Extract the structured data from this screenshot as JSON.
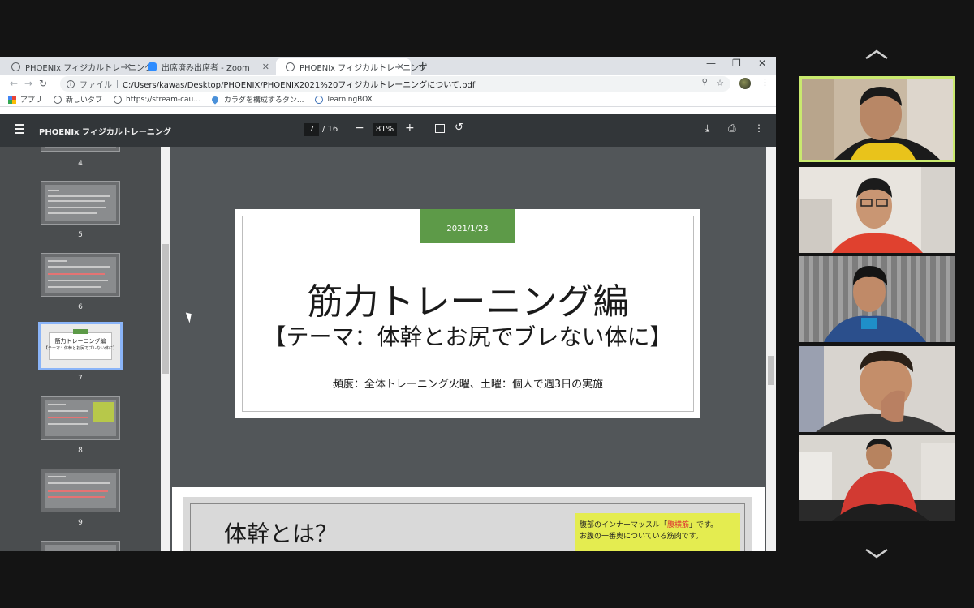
{
  "browser": {
    "tabs": [
      {
        "label": "PHOENIx フィジカルトレーニング",
        "icon": "globe-icon",
        "active": false
      },
      {
        "label": "出席済み出席者 - Zoom",
        "icon": "zoom-icon",
        "active": false
      },
      {
        "label": "PHOENIx フィジカルトレーニング",
        "icon": "globe-icon",
        "active": true
      }
    ],
    "new_tab": "+",
    "address": {
      "scheme_label": "ファイル",
      "url": "C:/Users/kawas/Desktop/PHOENIX/PHOENIX2021%20フィジカルトレーニングについて.pdf"
    },
    "bookmarks": [
      {
        "label": "アプリ",
        "icon": "apps-grid-icon"
      },
      {
        "label": "新しいタブ",
        "icon": "globe-icon"
      },
      {
        "label": "https://stream-cau...",
        "icon": "globe-icon"
      },
      {
        "label": "カラダを構成するタン...",
        "icon": "drop-icon"
      },
      {
        "label": "learningBOX",
        "icon": "learningbox-icon"
      }
    ]
  },
  "pdf": {
    "title": "PHOENIx フィジカルトレーニング",
    "current_page": "7",
    "page_total": "/ 16",
    "zoom": "81%",
    "thumbnails": [
      {
        "num": "4"
      },
      {
        "num": "5"
      },
      {
        "num": "6"
      },
      {
        "num": "7",
        "selected": true,
        "title": "筋力トレーニング編",
        "subtitle": "【テーマ：体幹とお尻でブレない体に】"
      },
      {
        "num": "8"
      },
      {
        "num": "9"
      }
    ],
    "slide": {
      "date": "2021/1/23",
      "title": "筋力トレーニング編",
      "theme": "【テーマ：体幹とお尻でブレない体に】",
      "frequency": "頻度：全体トレーニング火曜、土曜：個人で週3日の実施"
    },
    "next_page": {
      "heading": "体幹とは？",
      "note_line1_pre": "腹部のインナーマッスル「",
      "note_line1_red": "腹横筋",
      "note_line1_post": "」です。",
      "note_line2": "お腹の一番奥についている筋肉です。"
    }
  },
  "colors": {
    "slide_accent": "#5d9a48",
    "active_speaker": "#c9e96e",
    "note_bg": "#e4ec50"
  }
}
